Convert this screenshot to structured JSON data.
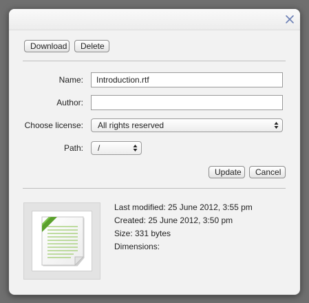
{
  "toolbar": {
    "download_label": "Download",
    "delete_label": "Delete"
  },
  "form": {
    "name_label": "Name:",
    "name_value": "Introduction.rtf",
    "author_label": "Author:",
    "author_value": "",
    "license_label": "Choose license:",
    "license_value": "All rights reserved",
    "path_label": "Path:",
    "path_value": "/"
  },
  "actions": {
    "update_label": "Update",
    "cancel_label": "Cancel"
  },
  "info": {
    "last_modified": "Last modified: 25 June 2012, 3:55 pm",
    "created": "Created: 25 June 2012, 3:50 pm",
    "size": "Size: 331 bytes",
    "dimensions": "Dimensions:"
  },
  "icons": {
    "close": "close-icon",
    "file_preview": "document-icon",
    "select_arrows": "updown-arrows-icon"
  },
  "colors": {
    "close_icon": "#6b7fb5",
    "doc_lines": "#9ccb6a",
    "doc_corner_ribbon": "#5aa02c"
  }
}
